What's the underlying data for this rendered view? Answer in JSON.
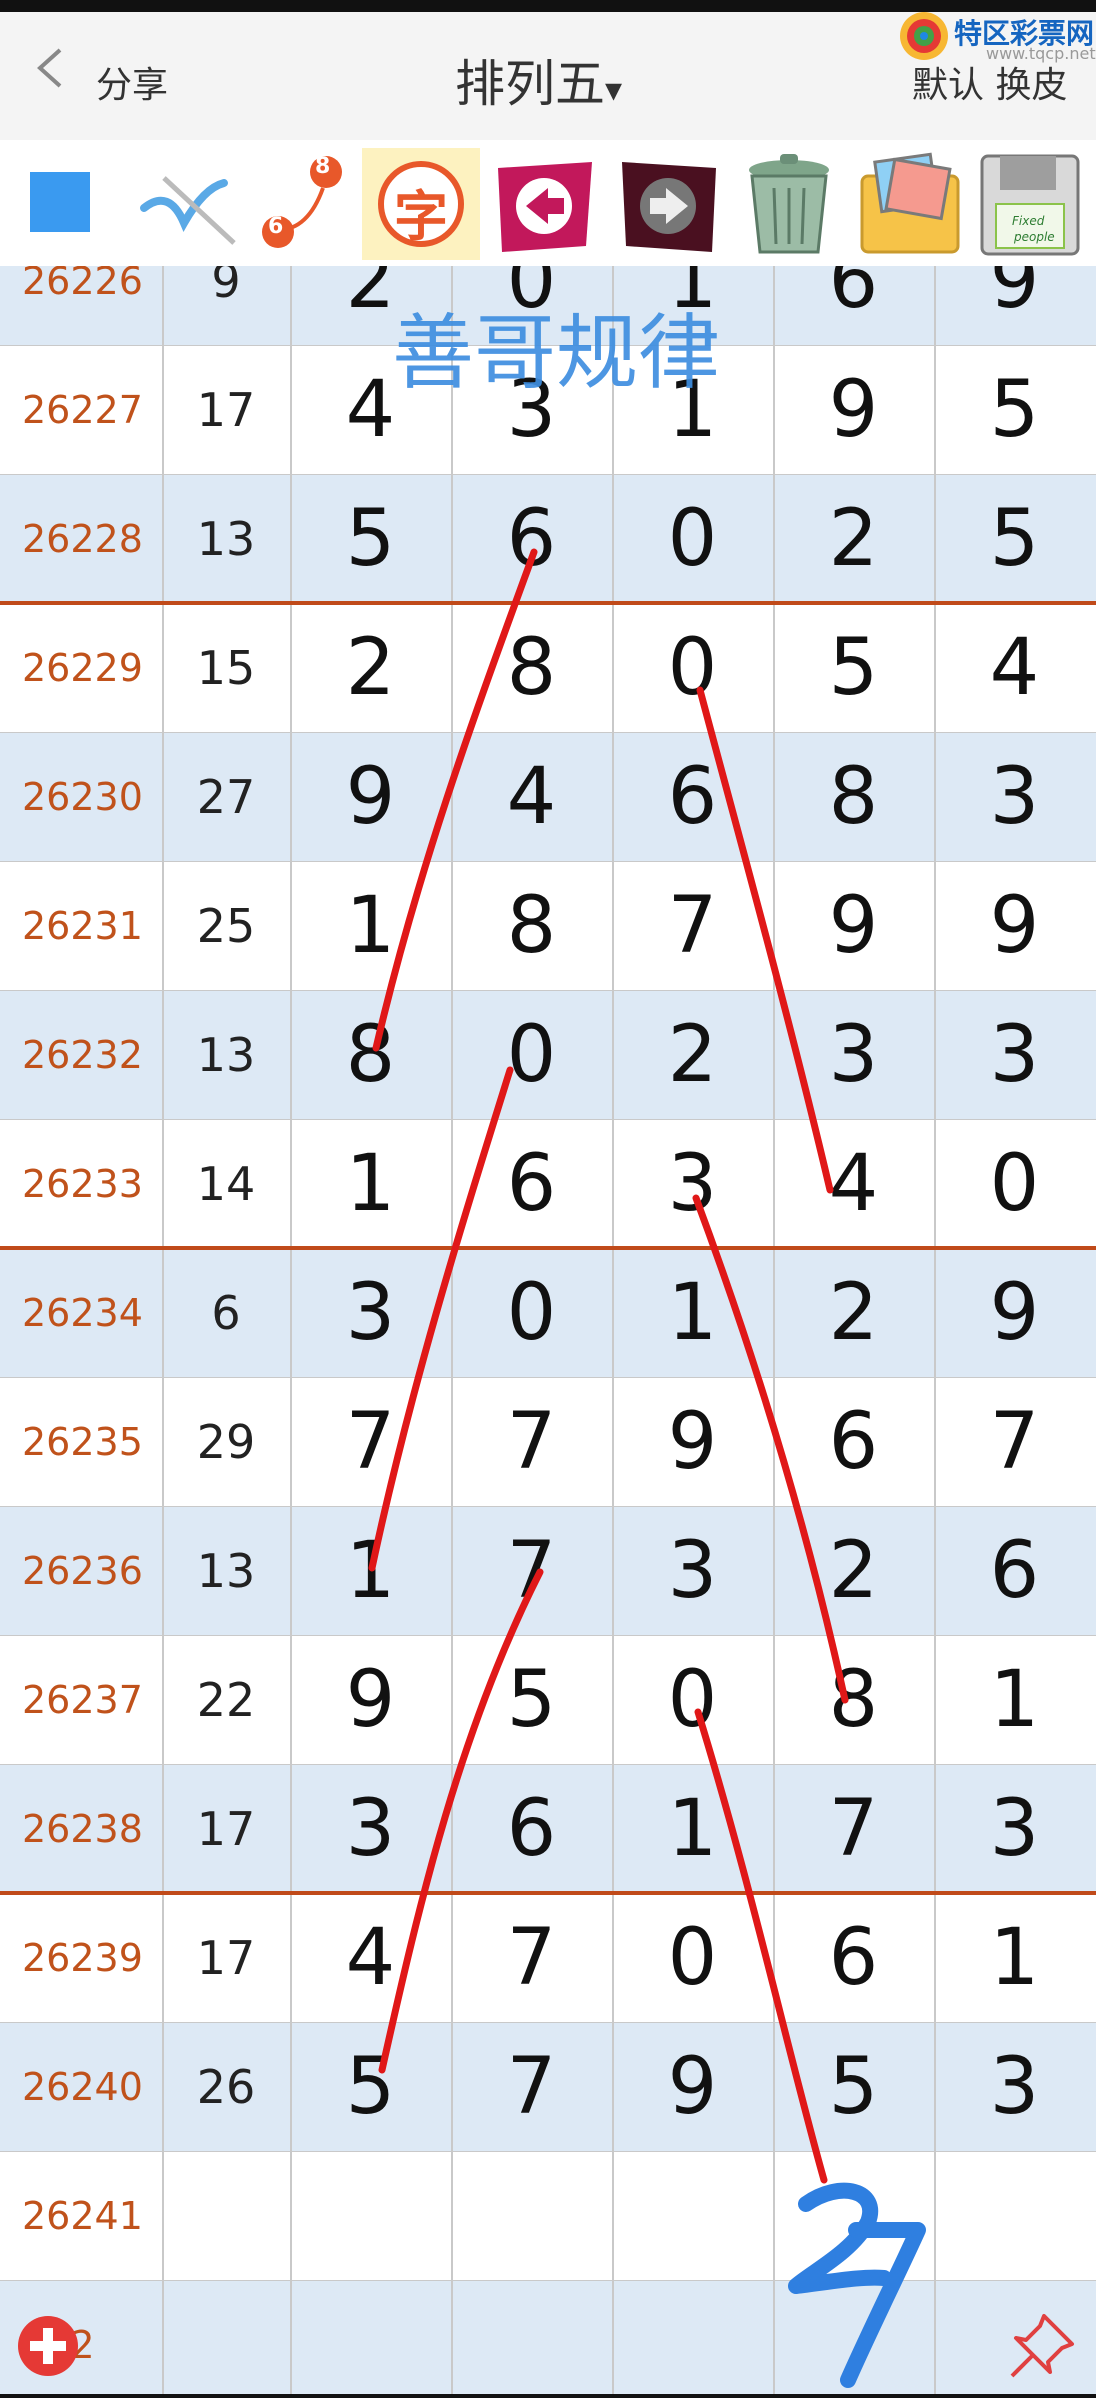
{
  "header": {
    "share_label": "分享",
    "title": "排列五",
    "title_caret": "▾",
    "logo_text": "特区彩票网",
    "logo_url": "www.tqcp.net",
    "skin_label": "默认 换皮"
  },
  "toolbar": {
    "badge_top": "8",
    "badge_bottom": "6",
    "char_label": "字",
    "save_label_1": "Fixed",
    "save_label_2": "people"
  },
  "watermark": "善哥规律",
  "rows": [
    {
      "issue": "26226",
      "sum": "9",
      "digits": [
        "2",
        "0",
        "1",
        "6",
        "9"
      ]
    },
    {
      "issue": "26227",
      "sum": "17",
      "digits": [
        "4",
        "3",
        "1",
        "9",
        "5"
      ]
    },
    {
      "issue": "26228",
      "sum": "13",
      "digits": [
        "5",
        "6",
        "0",
        "2",
        "5"
      ]
    },
    {
      "issue": "26229",
      "sum": "15",
      "digits": [
        "2",
        "8",
        "0",
        "5",
        "4"
      ]
    },
    {
      "issue": "26230",
      "sum": "27",
      "digits": [
        "9",
        "4",
        "6",
        "8",
        "3"
      ]
    },
    {
      "issue": "26231",
      "sum": "25",
      "digits": [
        "1",
        "8",
        "7",
        "9",
        "9"
      ]
    },
    {
      "issue": "26232",
      "sum": "13",
      "digits": [
        "8",
        "0",
        "2",
        "3",
        "3"
      ]
    },
    {
      "issue": "26233",
      "sum": "14",
      "digits": [
        "1",
        "6",
        "3",
        "4",
        "0"
      ]
    },
    {
      "issue": "26234",
      "sum": "6",
      "digits": [
        "3",
        "0",
        "1",
        "2",
        "9"
      ]
    },
    {
      "issue": "26235",
      "sum": "29",
      "digits": [
        "7",
        "7",
        "9",
        "6",
        "7"
      ]
    },
    {
      "issue": "26236",
      "sum": "13",
      "digits": [
        "1",
        "7",
        "3",
        "2",
        "6"
      ]
    },
    {
      "issue": "26237",
      "sum": "22",
      "digits": [
        "9",
        "5",
        "0",
        "8",
        "1"
      ]
    },
    {
      "issue": "26238",
      "sum": "17",
      "digits": [
        "3",
        "6",
        "1",
        "7",
        "3"
      ]
    },
    {
      "issue": "26239",
      "sum": "17",
      "digits": [
        "4",
        "7",
        "0",
        "6",
        "1"
      ]
    },
    {
      "issue": "26240",
      "sum": "26",
      "digits": [
        "5",
        "7",
        "9",
        "5",
        "3"
      ]
    },
    {
      "issue": "26241",
      "sum": "",
      "digits": [
        "",
        "",
        "",
        "",
        ""
      ]
    },
    {
      "issue": "242",
      "sum": "",
      "digits": [
        "",
        "",
        "",
        "",
        ""
      ]
    }
  ],
  "handwritten_note": "27",
  "colors": {
    "blue_row": "#dde9f5",
    "issue_text": "#c0521b",
    "divider_red": "#c04a1a",
    "annotation_red": "#e01818",
    "annotation_blue": "#2f7fe0"
  }
}
